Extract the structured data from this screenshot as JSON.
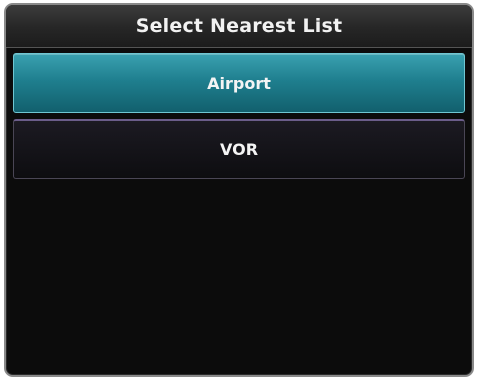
{
  "dialog": {
    "title": "Select Nearest List"
  },
  "list": {
    "items": [
      {
        "label": "Airport",
        "selected": true
      },
      {
        "label": "VOR",
        "selected": false
      }
    ]
  },
  "colors": {
    "selected_item": "#1f7f8f",
    "background": "#0c0c0c",
    "text": "#f4f4f4"
  }
}
